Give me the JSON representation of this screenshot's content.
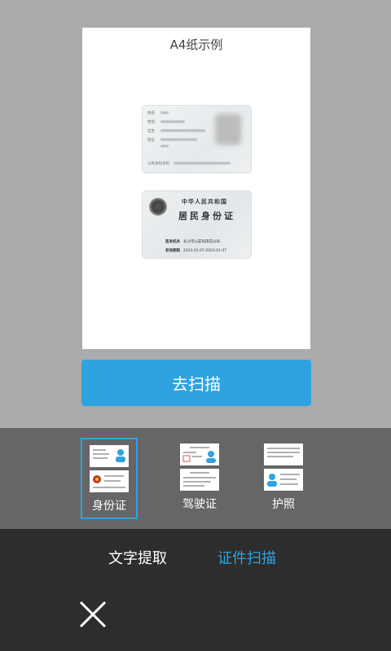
{
  "preview": {
    "title": "A4纸示例",
    "id_back": {
      "nation": "中华人民共和国",
      "card_name": "居民身份证",
      "issuer_label": "签发机关",
      "issuer_value": "长沙市公安局雨花分局",
      "validity_label": "有效期限",
      "validity_value": "2013.01.07-2023.01.07"
    }
  },
  "scan_button": {
    "label": "去扫描"
  },
  "doc_types": [
    {
      "label": "身份证",
      "icon": "id-card-icon",
      "selected": true
    },
    {
      "label": "驾驶证",
      "icon": "driver-license-icon",
      "selected": false
    },
    {
      "label": "护照",
      "icon": "passport-icon",
      "selected": false
    }
  ],
  "modes": {
    "text_extract": "文字提取",
    "cert_scan": "证件扫描",
    "active": "证件扫描"
  },
  "colors": {
    "accent": "#2ea3e0",
    "background_top": "#ababab",
    "selector_bar": "#666666",
    "bottom_bar": "#2d2d2d"
  },
  "close_icon": "close-icon"
}
